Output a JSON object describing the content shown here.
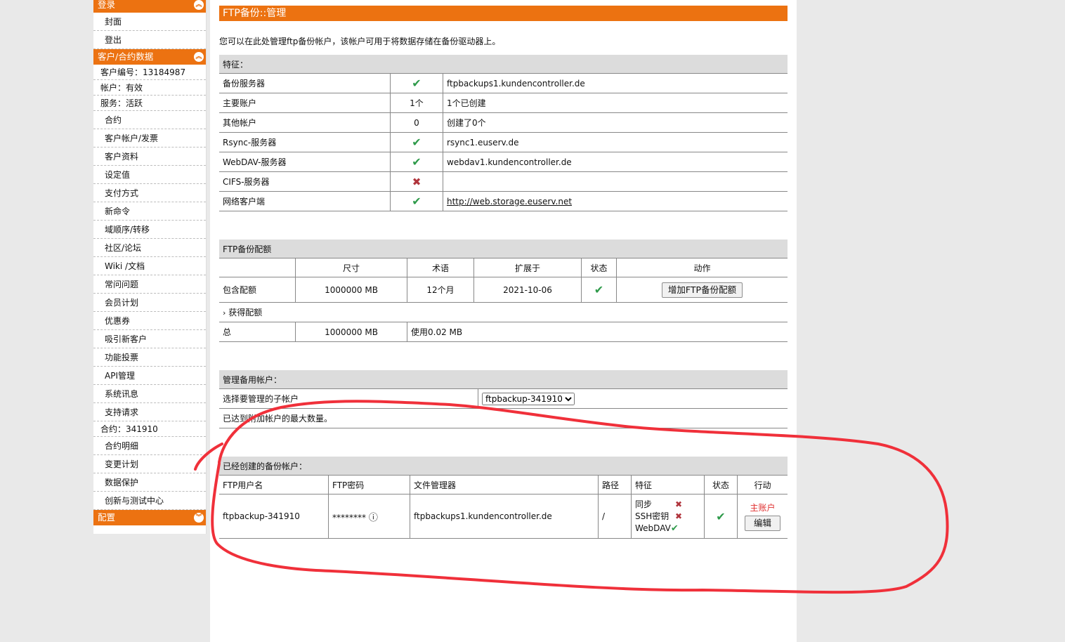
{
  "sidebar": {
    "login_header": "登录",
    "login_items": [
      "封面",
      "登出"
    ],
    "customer_header": "客户/合约数据",
    "customer_no": "客户编号：13184987",
    "account_status": "帐户：有效",
    "service_status": "服务：活跃",
    "customer_items": [
      "合约",
      "客户帐户/发票",
      "客户资料",
      "设定值",
      "支付方式",
      "新命令",
      "域顺序/转移",
      "社区/论坛",
      "Wiki /文档",
      "常问问题",
      "会员计划",
      "优惠券",
      "吸引新客户",
      "功能投票",
      "API管理",
      "系统讯息",
      "支持请求"
    ],
    "contract_no": "合约：341910",
    "contract_items": [
      "合约明细",
      "变更计划",
      "数据保护",
      "创新与测试中心"
    ],
    "config_header": "配置"
  },
  "page": {
    "title": "FTP备份::管理",
    "intro": "您可以在此处管理ftp备份帐户，该帐户可用于将数据存储在备份驱动器上。"
  },
  "features": {
    "header": "特征：",
    "rows": [
      {
        "name": "备份服务器",
        "status": "check",
        "value": "ftpbackups1.kundencontroller.de"
      },
      {
        "name": "主要账户",
        "status": "1个",
        "value": "1个已创建"
      },
      {
        "name": "其他帐户",
        "status": "0",
        "value": "创建了0个"
      },
      {
        "name": "Rsync-服务器",
        "status": "check",
        "value": "rsync1.euserv.de"
      },
      {
        "name": "WebDAV-服务器",
        "status": "check",
        "value": "webdav1.kundencontroller.de"
      },
      {
        "name": "CIFS-服务器",
        "status": "cross",
        "value": ""
      },
      {
        "name": "网络客户端",
        "status": "check",
        "value": "http://web.storage.euserv.net",
        "link": true
      }
    ]
  },
  "quota": {
    "header": "FTP备份配额",
    "columns": [
      "",
      "尺寸",
      "术语",
      "扩展于",
      "状态",
      "动作"
    ],
    "included": {
      "label": "包含配额",
      "size": "1000000 MB",
      "term": "12个月",
      "extended": "2021-10-06",
      "button": "增加FTP备份配额"
    },
    "obtained_label": "获得配额",
    "total": {
      "label": "总",
      "size": "1000000 MB",
      "used": "使用0.02 MB"
    }
  },
  "manage": {
    "header": "管理备用帐户：",
    "select_label": "选择要管理的子帐户",
    "select_value": "ftpbackup-341910",
    "max_note": "已达到附加帐户的最大数量。"
  },
  "accounts": {
    "header": "已经创建的备份帐户：",
    "columns": [
      "FTP用户名",
      "FTP密码",
      "文件管理器",
      "路径",
      "特征",
      "状态",
      "行动"
    ],
    "row": {
      "username": "ftpbackup-341910",
      "password": "********",
      "info_icon": "ⓘ",
      "file_manager": "ftpbackups1.kundencontroller.de",
      "path": "/",
      "features": [
        {
          "name": "同步",
          "enabled": false
        },
        {
          "name": "SSH密钥",
          "enabled": false
        },
        {
          "name": "WebDAV",
          "enabled": true
        }
      ],
      "main_account": "主账户",
      "edit_button": "编辑"
    }
  },
  "colors": {
    "brand_orange": "#ec7211",
    "check_green": "#2e9a4a",
    "cross_red": "#b0343c",
    "annotation_red": "#f0303a"
  },
  "icons": {
    "check": "check-icon",
    "cross": "cross-icon",
    "collapse": "chevron-icon",
    "info": "info-icon"
  }
}
